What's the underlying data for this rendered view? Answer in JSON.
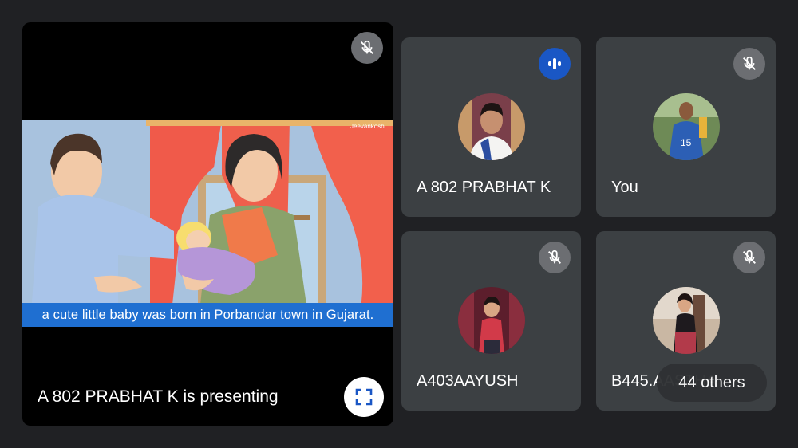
{
  "presentation": {
    "caption": "a cute little baby was born in Porbandar town in Gujarat.",
    "presenting_text": "A 802 PRABHAT K is presenting",
    "watermark": "Jeevankosh"
  },
  "tiles": [
    {
      "name": "A 802 PRABHAT K",
      "status": "speaking"
    },
    {
      "name": "You",
      "status": "muted"
    },
    {
      "name": "A403AAYUSH",
      "status": "muted"
    },
    {
      "name": "B445.AASTHA",
      "status": "muted"
    }
  ],
  "others_label": "44 others",
  "colors": {
    "background": "#202124",
    "tile": "#3c4043",
    "speaking_badge": "#1a57c5",
    "mute_badge": "#6c6e72",
    "caption_bar": "#1f6fd1"
  }
}
